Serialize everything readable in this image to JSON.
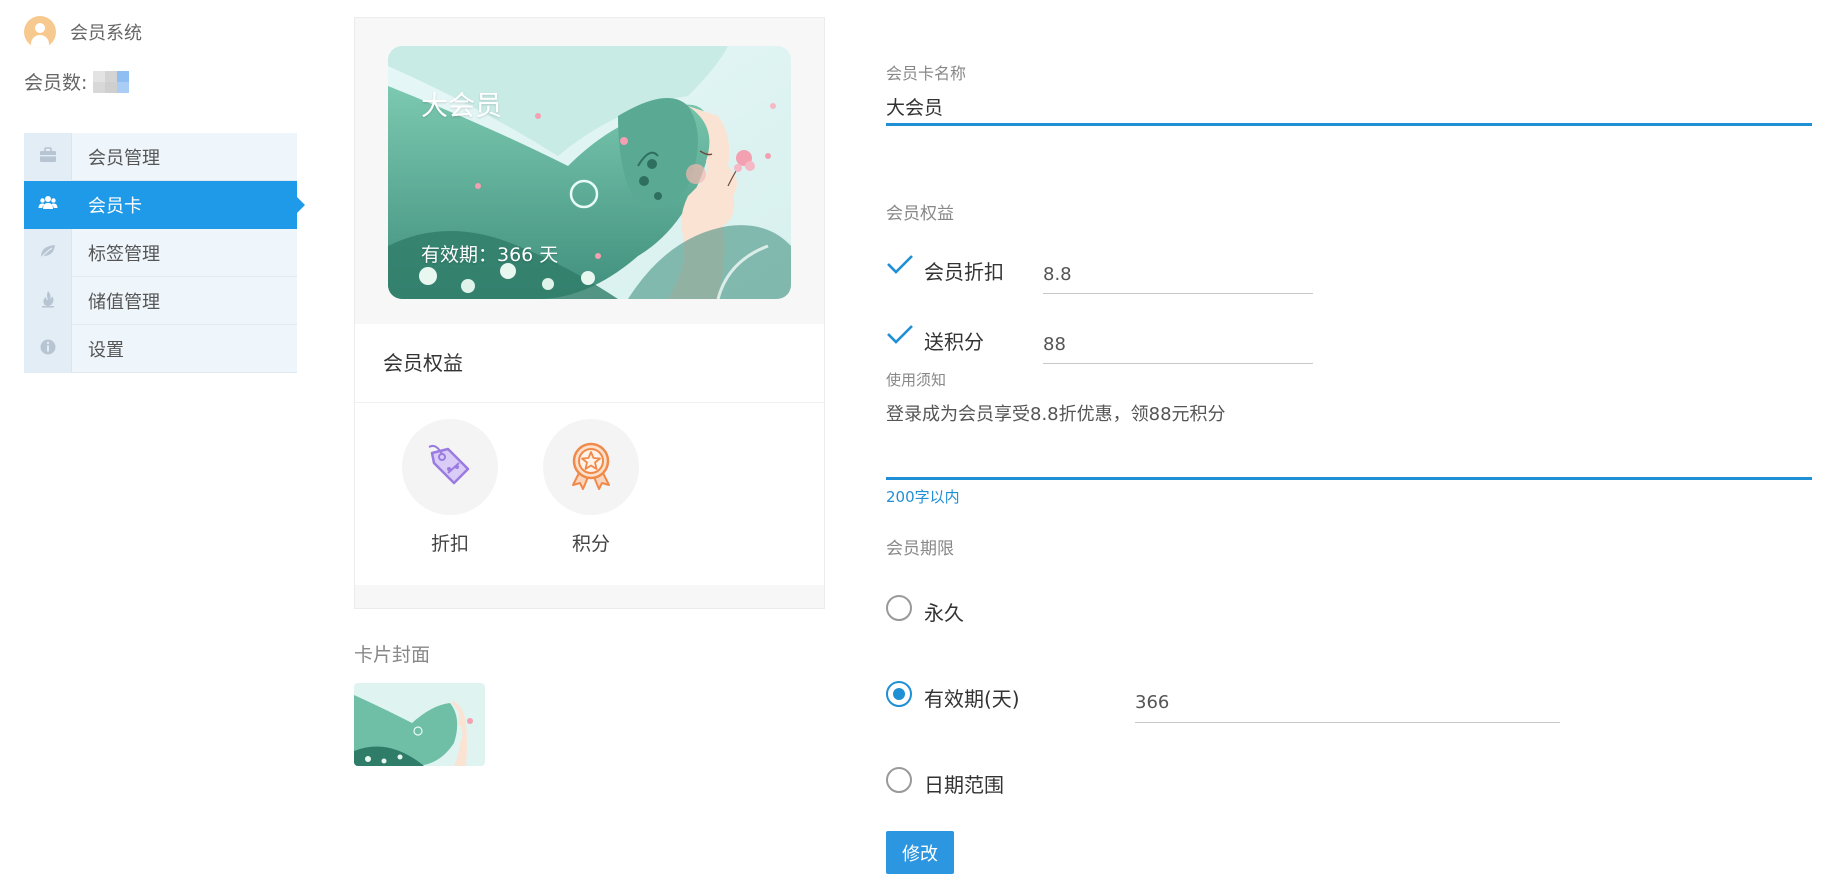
{
  "brand": {
    "title": "会员系统"
  },
  "stats": {
    "member_count_label": "会员数:"
  },
  "sidebar": {
    "items": [
      {
        "label": "会员管理",
        "icon": "briefcase-icon",
        "active": false
      },
      {
        "label": "会员卡",
        "icon": "users-icon",
        "active": true
      },
      {
        "label": "标签管理",
        "icon": "leaf-icon",
        "active": false
      },
      {
        "label": "储值管理",
        "icon": "fire-icon",
        "active": false
      },
      {
        "label": "设置",
        "icon": "info-icon",
        "active": false
      }
    ]
  },
  "preview": {
    "card_name": "大会员",
    "card_validity": "有效期：366 天",
    "rights_title": "会员权益",
    "benefits": [
      {
        "label": "折扣",
        "icon": "discount-tag-icon",
        "color": "#9b7be0"
      },
      {
        "label": "积分",
        "icon": "medal-icon",
        "color": "#f08a4b"
      }
    ],
    "cover_label": "卡片封面"
  },
  "form": {
    "name_label": "会员卡名称",
    "name_value": "大会员",
    "rights_label": "会员权益",
    "discount_label": "会员折扣",
    "discount_value": "8.8",
    "points_label": "送积分",
    "points_value": "88",
    "notice_label": "使用须知",
    "notice_value": "登录成为会员享受8.8折优惠，领88元积分",
    "notice_hint": "200字以内",
    "period_label": "会员期限",
    "period_options": [
      {
        "label": "永久",
        "checked": false
      },
      {
        "label": "有效期(天)",
        "checked": true
      },
      {
        "label": "日期范围",
        "checked": false
      }
    ],
    "days_value": "366",
    "submit_label": "修改"
  },
  "colors": {
    "accent": "#1f9ae8",
    "sidebar_bg": "#eef5fb",
    "discount_icon": "#9b7be0",
    "points_icon": "#f08a4b"
  }
}
